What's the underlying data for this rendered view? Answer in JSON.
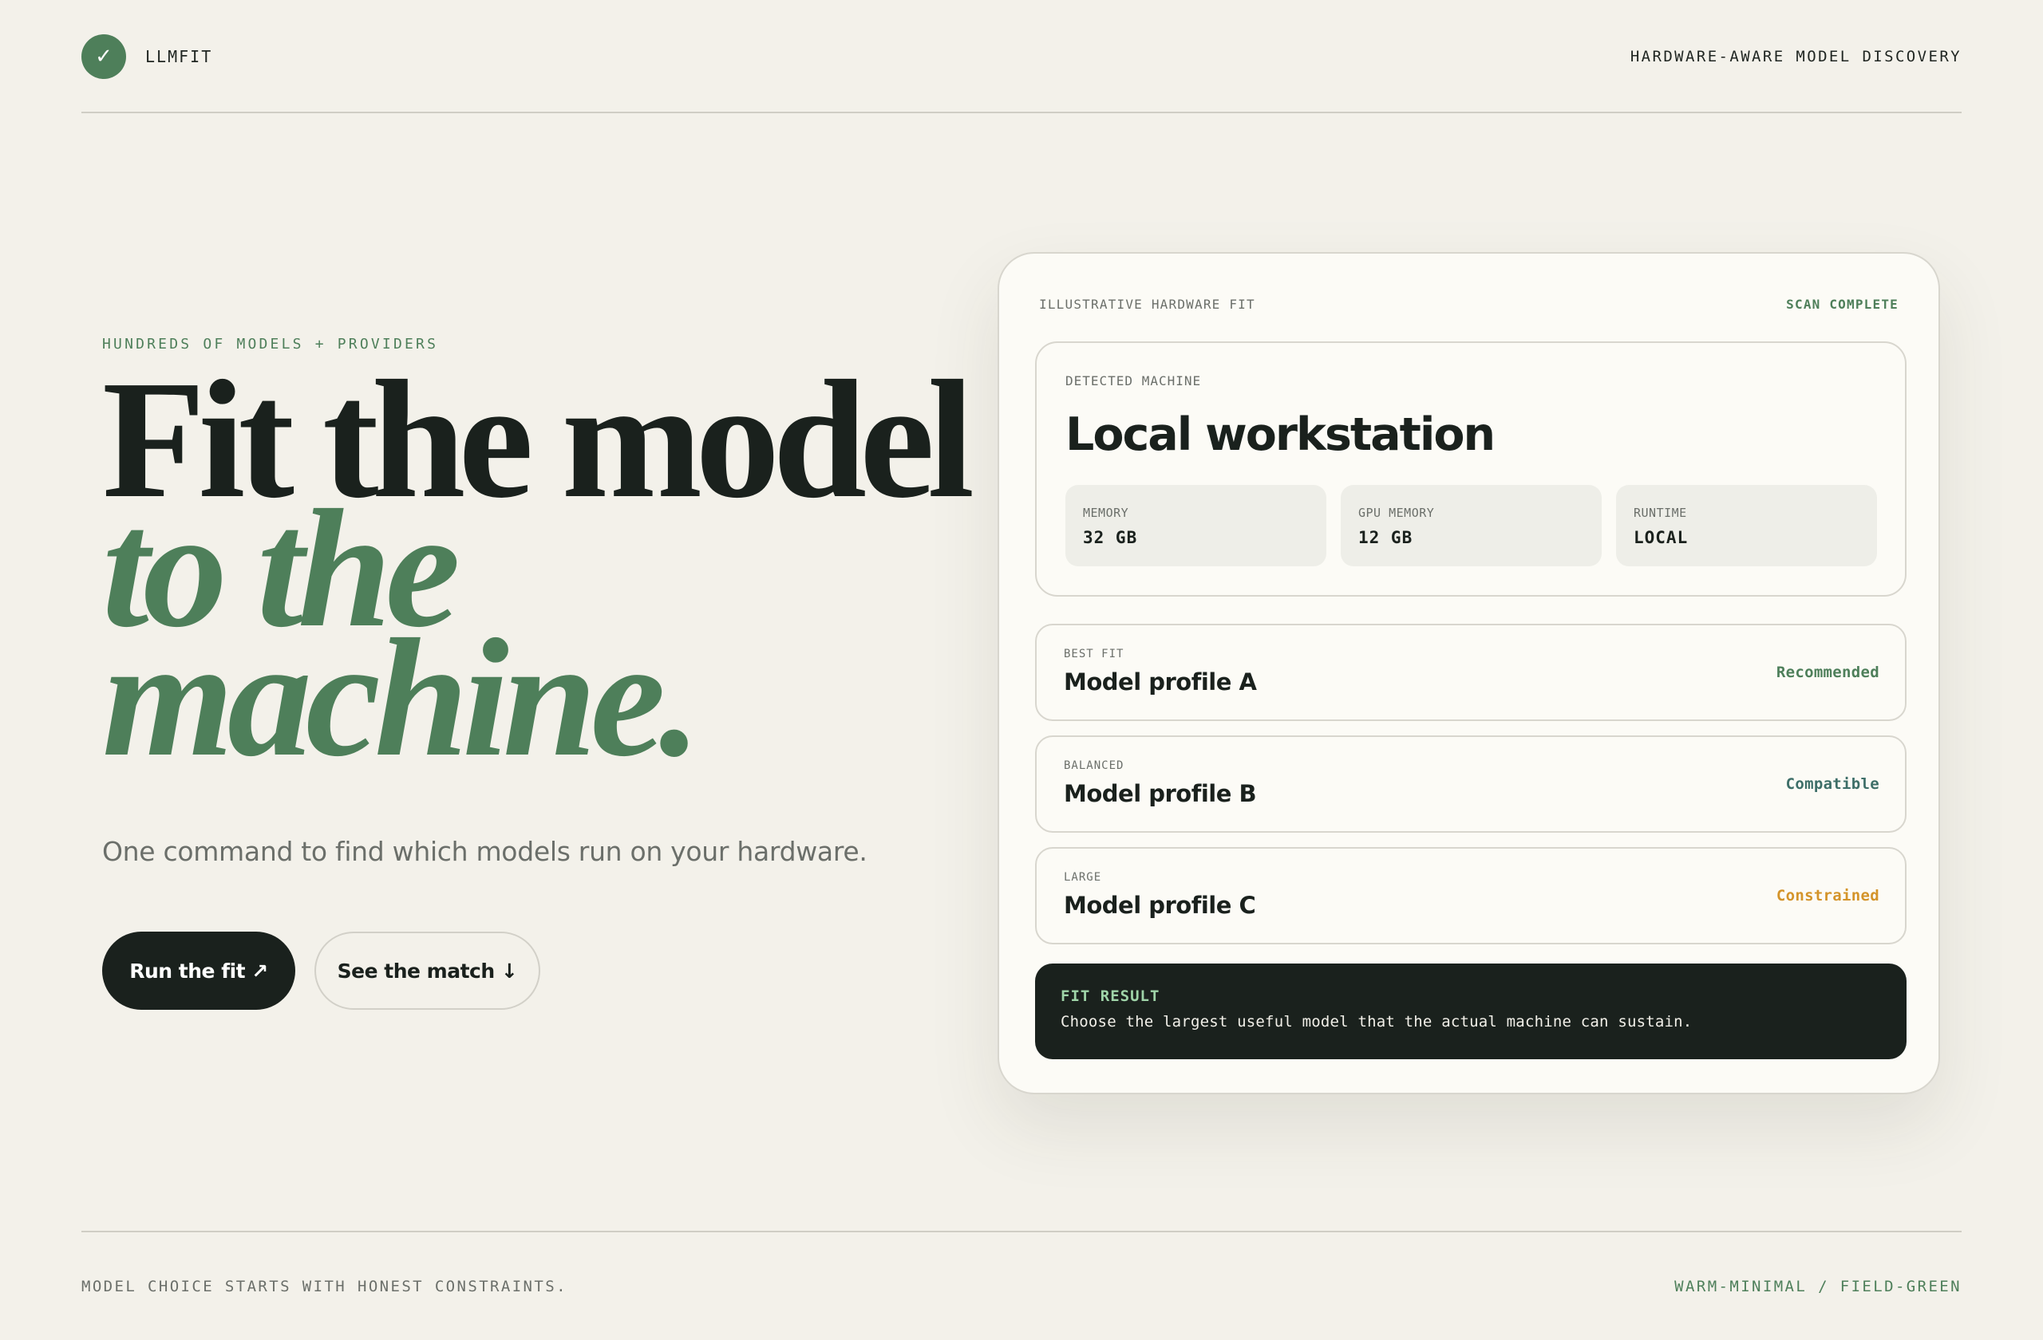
{
  "header": {
    "brand_icon": "check-icon",
    "brand_glyph": "✓",
    "brand_name": "LLMFIT",
    "tagline": "HARDWARE-AWARE MODEL DISCOVERY"
  },
  "hero": {
    "eyebrow": "HUNDREDS OF MODELS + PROVIDERS",
    "headline_line1": "Fit the model",
    "headline_line2": "to the",
    "headline_line3": "machine.",
    "subtitle": "One command to find which models run on your hardware.",
    "primary_cta": "Run the fit ↗",
    "secondary_cta": "See the match ↓"
  },
  "panel": {
    "label": "ILLUSTRATIVE HARDWARE FIT",
    "status": "SCAN COMPLETE",
    "machine": {
      "label": "DETECTED MACHINE",
      "title": "Local workstation",
      "stats": [
        {
          "label": "MEMORY",
          "value": "32 GB"
        },
        {
          "label": "GPU MEMORY",
          "value": "12 GB"
        },
        {
          "label": "RUNTIME",
          "value": "LOCAL"
        }
      ]
    },
    "profiles": [
      {
        "tag": "BEST FIT",
        "name": "Model profile A",
        "status": "Recommended",
        "status_color": "#4e7f5a"
      },
      {
        "tag": "BALANCED",
        "name": "Model profile B",
        "status": "Compatible",
        "status_color": "#3d6e68"
      },
      {
        "tag": "LARGE",
        "name": "Model profile C",
        "status": "Constrained",
        "status_color": "#d4942a"
      }
    ],
    "result": {
      "title": "FIT RESULT",
      "text": "Choose the largest useful model that the actual machine can sustain."
    }
  },
  "footer": {
    "left": "MODEL CHOICE STARTS WITH HONEST CONSTRAINTS.",
    "right": "WARM-MINIMAL / FIELD-GREEN"
  },
  "colors": {
    "background": "#f3f1ea",
    "accent": "#4e7f5a",
    "ink": "#1a211d",
    "warning": "#d4942a"
  }
}
